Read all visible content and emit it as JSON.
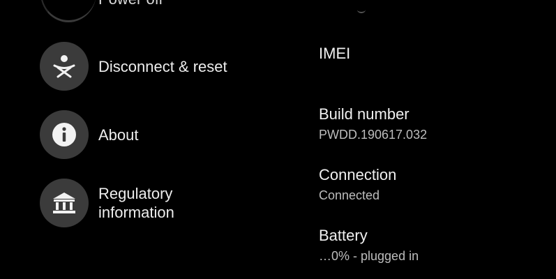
{
  "menu": {
    "partial_top_label": "Power off",
    "items": [
      {
        "label": "Disconnect & reset",
        "icon": "disconnect-reset-icon"
      },
      {
        "label": "About",
        "icon": "info-icon"
      },
      {
        "label_line1": "Regulatory",
        "label_line2": "information",
        "icon": "bank-icon"
      }
    ]
  },
  "about": {
    "imei": {
      "title": "IMEI",
      "value": ""
    },
    "build": {
      "title": "Build number",
      "value": "PWDD.190617.032"
    },
    "connection": {
      "title": "Connection",
      "value": "Connected"
    },
    "battery": {
      "title": "Battery",
      "value": "…0% - plugged in"
    }
  },
  "colors": {
    "background": "#000000",
    "icon_circle": "#3b3b3b",
    "text_primary": "#ececec",
    "text_secondary": "#bdbdbd"
  }
}
